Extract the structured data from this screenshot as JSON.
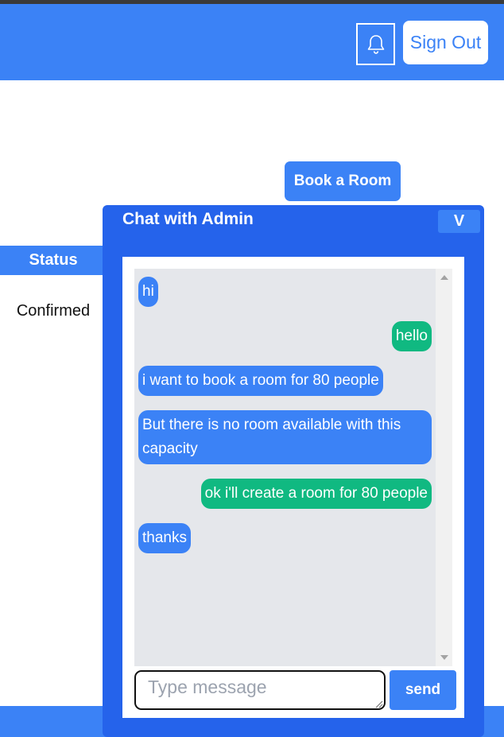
{
  "header": {
    "bell_icon": "bell-icon",
    "signout_label": "Sign Out"
  },
  "book_room_label": "Book a Room",
  "table": {
    "status_header": "Status",
    "rows": [
      {
        "status": "Confirmed"
      }
    ]
  },
  "chat": {
    "title": "Chat with Admin",
    "collapse_label": "V",
    "messages": [
      {
        "text": "hi",
        "from": "user"
      },
      {
        "text": "hello",
        "from": "admin"
      },
      {
        "text": "i want to book a room for 80 people",
        "from": "user"
      },
      {
        "text": "But there is no room available with this capacity",
        "from": "user"
      },
      {
        "text": "ok i'll create a room for 80 people",
        "from": "admin"
      },
      {
        "text": "thanks",
        "from": "user"
      }
    ],
    "input_placeholder": "Type message",
    "input_value": "",
    "send_label": "send"
  },
  "colors": {
    "primary": "#3b82f6",
    "panel": "#2563eb",
    "admin_bubble": "#10b981",
    "user_bubble": "#3b82f6"
  }
}
